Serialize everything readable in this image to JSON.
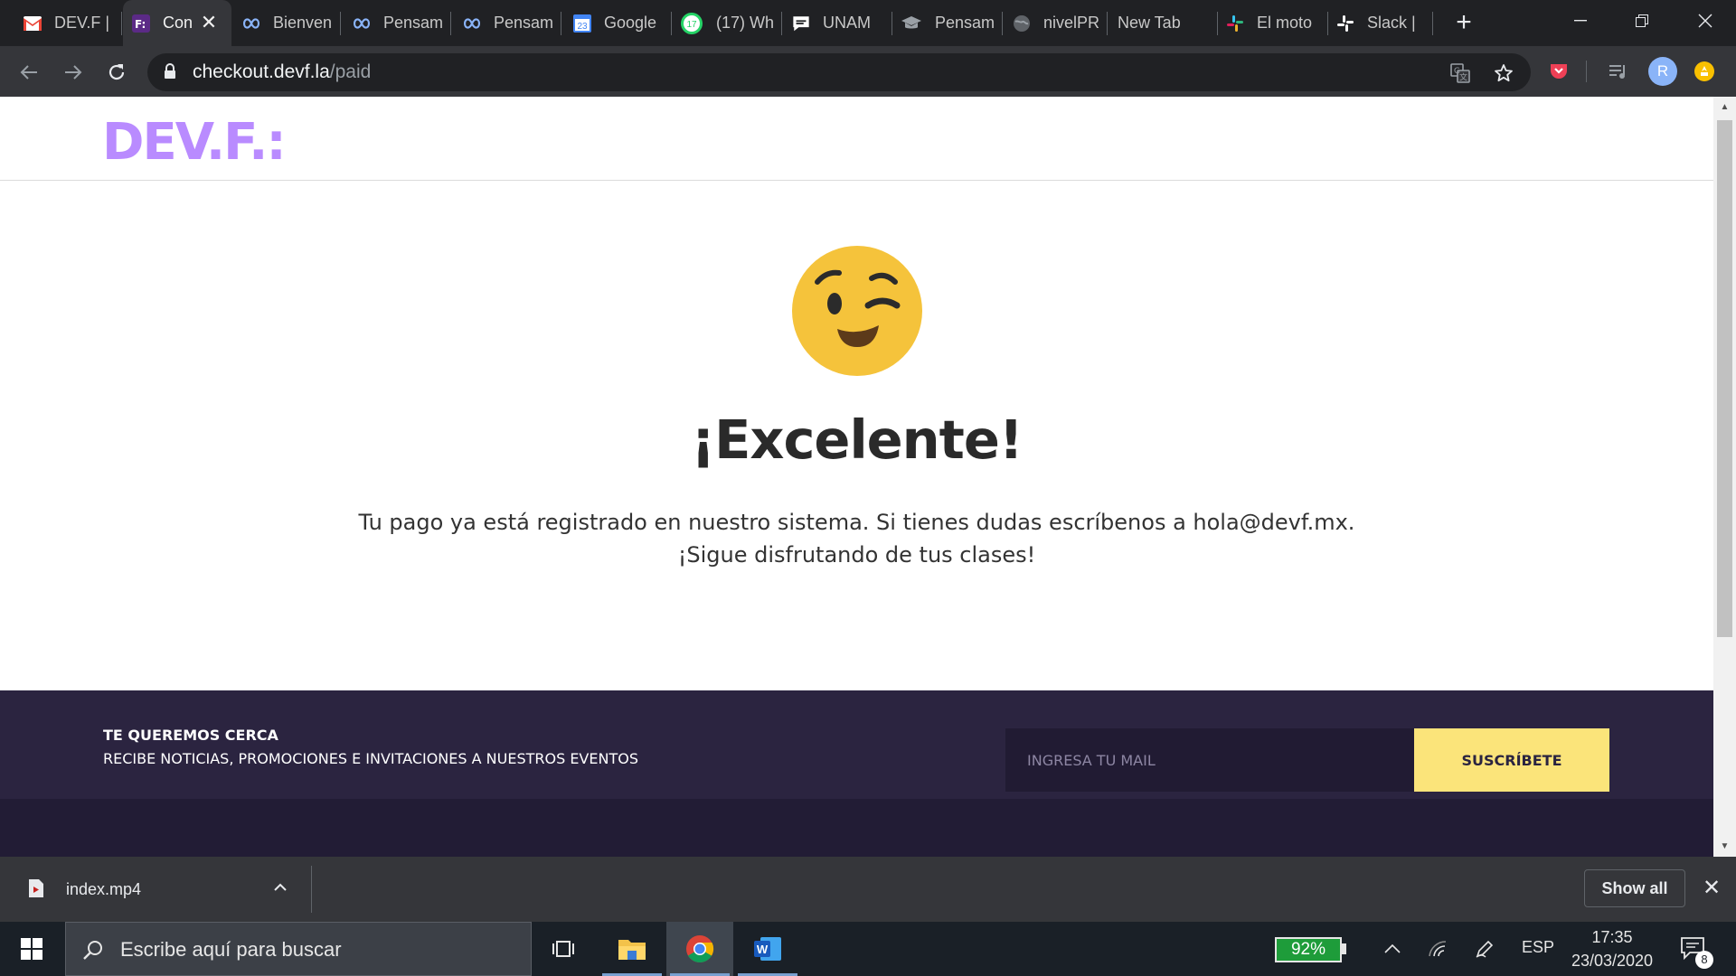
{
  "browser": {
    "tabs": [
      {
        "label": "DEV.F |",
        "icon": "gmail-icon",
        "active": false
      },
      {
        "label": "Con",
        "icon": "devf-favicon-icon",
        "active": true
      },
      {
        "label": "Bienven",
        "icon": "infinity-icon",
        "active": false
      },
      {
        "label": "Pensam",
        "icon": "infinity-icon",
        "active": false
      },
      {
        "label": "Pensam",
        "icon": "infinity-icon",
        "active": false
      },
      {
        "label": "Google",
        "icon": "google-calendar-icon",
        "active": false
      },
      {
        "label": "(17) Wh",
        "icon": "whatsapp-icon",
        "active": false
      },
      {
        "label": "UNAM",
        "icon": "chat-icon",
        "active": false
      },
      {
        "label": "Pensam",
        "icon": "graduation-cap-icon",
        "active": false
      },
      {
        "label": "nivelPR",
        "icon": "globe-icon",
        "active": false
      },
      {
        "label": "New Tab",
        "icon": "",
        "active": false
      },
      {
        "label": "El moto",
        "icon": "slack-icon",
        "active": false
      },
      {
        "label": "Slack |",
        "icon": "slack-icon",
        "active": false
      }
    ],
    "calendar_day": "23",
    "whatsapp_count": "17",
    "url_host": "checkout.devf.la",
    "url_path": "/paid",
    "avatar_initial": "R"
  },
  "page": {
    "logo": "DEV.F.:",
    "heading": "¡Excelente!",
    "message_line1": "Tu pago ya está registrado en nuestro sistema. Si tienes dudas escríbenos a hola@devf.mx.",
    "message_line2": "¡Sigue disfrutando de tus clases!",
    "footer_title": "TE QUEREMOS CERCA",
    "footer_subtitle": "RECIBE NOTICIAS, PROMOCIONES E INVITACIONES A NUESTROS EVENTOS",
    "email_placeholder": "INGRESA TU MAIL",
    "subscribe_label": "SUSCRÍBETE"
  },
  "download_shelf": {
    "file_name": "index.mp4",
    "show_all_label": "Show all"
  },
  "taskbar": {
    "search_placeholder": "Escribe aquí para buscar",
    "battery": "92%",
    "language": "ESP",
    "time": "17:35",
    "date": "23/03/2020",
    "notification_count": "8"
  },
  "colors": {
    "brand_purple": "#b98bff",
    "footer_bg": "#2b2440",
    "subscribe_yellow": "#fbe47a",
    "emoji_yellow": "#f5c33b"
  }
}
